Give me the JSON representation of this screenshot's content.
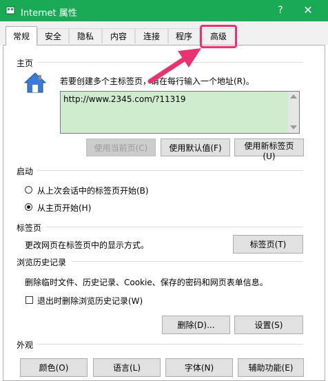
{
  "window": {
    "title": "Internet 属性",
    "help_glyph": "?",
    "close_glyph": "✕"
  },
  "tabs": [
    {
      "label": "常规",
      "active": true
    },
    {
      "label": "安全",
      "active": false
    },
    {
      "label": "隐私",
      "active": false
    },
    {
      "label": "内容",
      "active": false
    },
    {
      "label": "连接",
      "active": false
    },
    {
      "label": "程序",
      "active": false
    },
    {
      "label": "高级",
      "active": false,
      "highlighted": true
    }
  ],
  "homepage": {
    "section_label": "主页",
    "instruction": "若要创建多个主标签页，请在每行输入一个地址(R)。",
    "url_value": "http://www.2345.com/?11319",
    "btn_use_current": "使用当前页(C)",
    "btn_use_default": "使用默认值(F)",
    "btn_use_new_tab": "使用新标签页(U)"
  },
  "startup": {
    "section_label": "启动",
    "option_last_session": "从上次会话中的标签页开始(B)",
    "option_homepage": "从主页开始(H)",
    "selected": "option_homepage"
  },
  "tabs_section": {
    "section_label": "标签页",
    "description": "更改网页在标签页中的显示方式。",
    "btn_tabs": "标签页(T)"
  },
  "history": {
    "section_label": "浏览历史记录",
    "description": "删除临时文件、历史记录、Cookie、保存的密码和网页表单信息。",
    "checkbox_label": "退出时删除浏览历史记录(W)",
    "checkbox_checked": false,
    "btn_delete": "删除(D)...",
    "btn_settings": "设置(S)"
  },
  "appearance": {
    "section_label": "外观",
    "btn_colors": "颜色(O)",
    "btn_languages": "语言(L)",
    "btn_fonts": "字体(N)",
    "btn_accessibility": "辅助功能(E)"
  },
  "colors": {
    "titlebar": "#1aaa55",
    "highlight": "#e7336f",
    "homepage_bg": "#cfeccf"
  }
}
